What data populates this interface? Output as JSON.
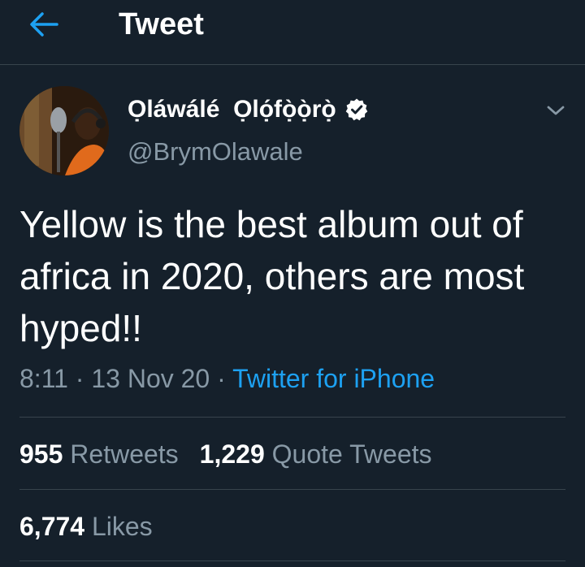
{
  "header": {
    "title": "Tweet",
    "back_icon": "arrow-left-icon"
  },
  "author": {
    "display_name": "Ọláwálé  Ọlọ́fọ̀ọ̀rọ̀",
    "handle": "@BrymOlawale",
    "verified_icon": "verified-badge-icon"
  },
  "tweet": {
    "text": "Yellow is the best album out of africa in 2020, others are most hyped!!",
    "time": "8:11",
    "separator": "·",
    "date": "13 Nov 20",
    "source": "Twitter for iPhone"
  },
  "stats": {
    "retweets_count": "955",
    "retweets_label": "Retweets",
    "quotes_count": "1,229",
    "quotes_label": "Quote Tweets",
    "likes_count": "6,774",
    "likes_label": "Likes"
  },
  "colors": {
    "background": "#15202b",
    "accent": "#1da1f2",
    "secondary_text": "#8899a6",
    "divider": "#38444d"
  }
}
